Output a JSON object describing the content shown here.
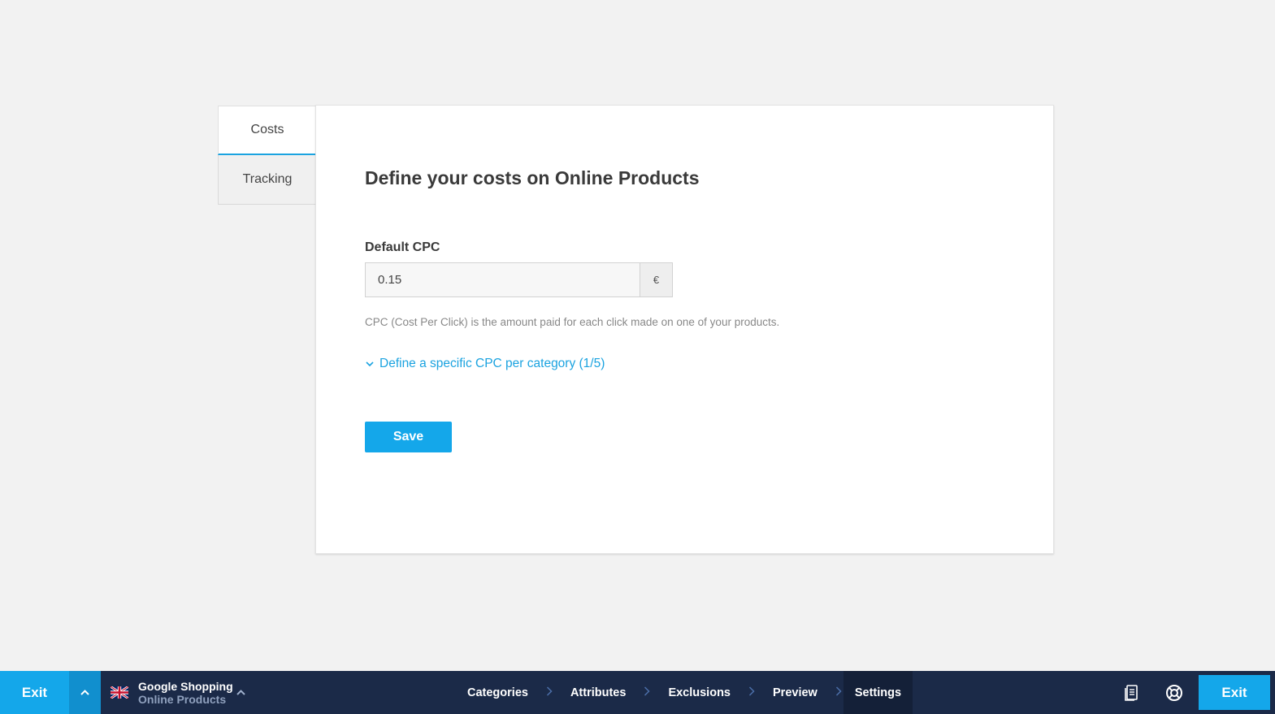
{
  "tabs": [
    {
      "label": "Costs",
      "active": true
    },
    {
      "label": "Tracking",
      "active": false
    }
  ],
  "card": {
    "title": "Define your costs on Online Products",
    "cpc_label": "Default CPC",
    "cpc_value": "0.15",
    "currency": "€",
    "help_text": "CPC (Cost Per Click) is the amount paid for each click made on one of your products.",
    "expand_link": "Define a specific CPC per category (1/5)",
    "save_label": "Save"
  },
  "bottom_bar": {
    "exit_left": "Exit",
    "project_name": "Google Shopping",
    "project_sub": "Online Products",
    "steps": [
      "Categories",
      "Attributes",
      "Exclusions",
      "Preview",
      "Settings"
    ],
    "active_step": "Settings",
    "exit_right": "Exit",
    "icons": [
      "document-icon",
      "lifebuoy-icon"
    ]
  },
  "colors": {
    "accent": "#14a7ea",
    "bar_background": "#1b2a48",
    "link": "#1ba3e0"
  }
}
